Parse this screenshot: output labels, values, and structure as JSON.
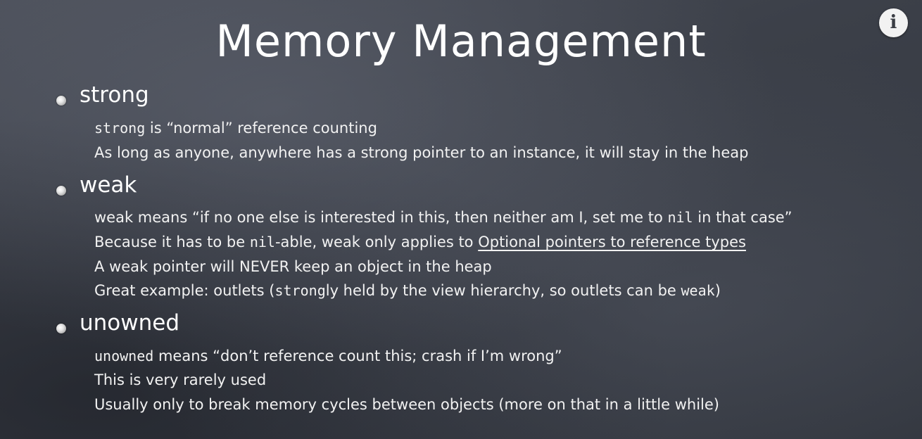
{
  "slide": {
    "title": "Memory Management",
    "info_icon": "i",
    "sections": {
      "strong": {
        "heading": "strong",
        "line1_code": "strong",
        "line1_rest": " is “normal” reference counting",
        "line2": "As long as anyone, anywhere has a strong pointer to an instance, it will stay in the heap"
      },
      "weak": {
        "heading": "weak",
        "line1_a": "weak means “if no one else is interested in this, then neither am I, set me to ",
        "line1_code": "nil",
        "line1_b": " in that case”",
        "line2_a": "Because it has to be ",
        "line2_code": "nil",
        "line2_b": "-able, weak only applies to ",
        "line2_link": "Optional pointers to reference types",
        "line3": "A weak pointer will NEVER keep an object in the heap",
        "line4_a": "Great example: outlets (",
        "line4_code": "strong",
        "line4_b": "ly held by the view hierarchy, so outlets can be ",
        "line4_code2": "weak",
        "line4_c": ")"
      },
      "unowned": {
        "heading": "unowned",
        "line1_code": "unowned",
        "line1_rest": " means “don’t reference count this; crash if I’m wrong”",
        "line2": "This is very rarely used",
        "line3": "Usually only to break memory cycles between objects (more on that in a little while)"
      }
    }
  },
  "colors": {
    "background": "#3c4049",
    "text": "#f2f2f2",
    "info_button_bg": "#f2f2f2"
  },
  "icons": {
    "info": "info-icon",
    "bullet": "bullet-icon"
  }
}
